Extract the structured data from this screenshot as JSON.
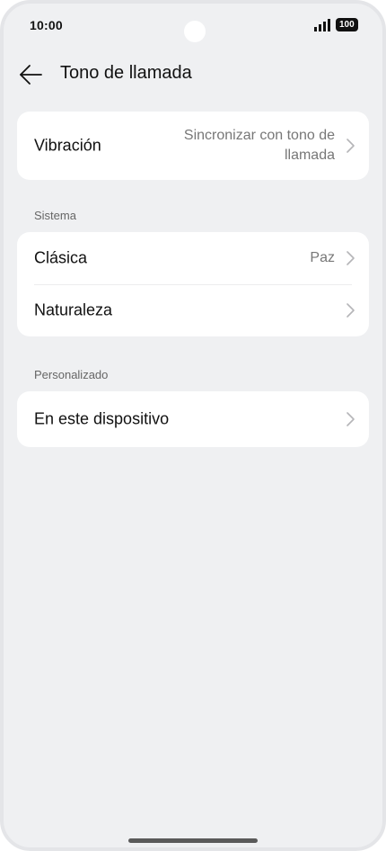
{
  "status_bar": {
    "time": "10:00",
    "battery": "100"
  },
  "header": {
    "title": "Tono de llamada",
    "back_icon": "arrow-left-icon"
  },
  "vibration": {
    "label": "Vibración",
    "value_line1": "Sincronizar con tono de",
    "value_line2": "llamada"
  },
  "system_section": {
    "title": "Sistema",
    "items": [
      {
        "label": "Clásica",
        "value": "Paz"
      },
      {
        "label": "Naturaleza",
        "value": ""
      }
    ]
  },
  "custom_section": {
    "title": "Personalizado",
    "items": [
      {
        "label": "En este dispositivo",
        "value": ""
      }
    ]
  },
  "colors": {
    "background": "#eff0f2",
    "card": "#ffffff",
    "secondary_text": "#777777"
  }
}
